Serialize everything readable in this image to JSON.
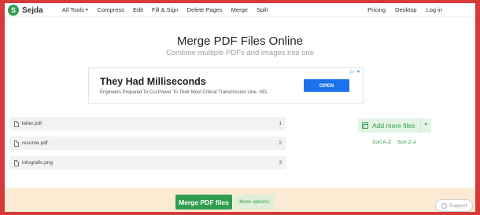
{
  "brand": {
    "logo_letter": "S",
    "name": "Sejda",
    "accent": "#2f9e4f",
    "frame_color": "#d83a3a"
  },
  "nav": {
    "left": [
      "All Tools",
      "Compress",
      "Edit",
      "Fill & Sign",
      "Delete Pages",
      "Merge",
      "Split"
    ],
    "right": [
      "Pricing",
      "Desktop",
      "Log in"
    ]
  },
  "page": {
    "title": "Merge PDF Files Online",
    "subtitle": "Combine multiple PDFs and images into one"
  },
  "ad": {
    "headline": "They Had Milliseconds",
    "subline": "Engineers Prepared To Cut Power To Their Most Critical Transmission Line. SEL",
    "button": "OPEN",
    "icons": [
      "adchoices-icon",
      "close-icon"
    ]
  },
  "files": [
    {
      "name": "letter.pdf",
      "index": "1"
    },
    {
      "name": "resume.pdf",
      "index": "2"
    },
    {
      "name": "infografic.png",
      "index": "3"
    }
  ],
  "actions": {
    "add_more": "Add more files",
    "sort_az": "Sort A-Z",
    "sort_za": "Sort Z-A"
  },
  "bottom_bar": {
    "merge": "Merge PDF files",
    "more_options": "More options",
    "support": "Support"
  }
}
